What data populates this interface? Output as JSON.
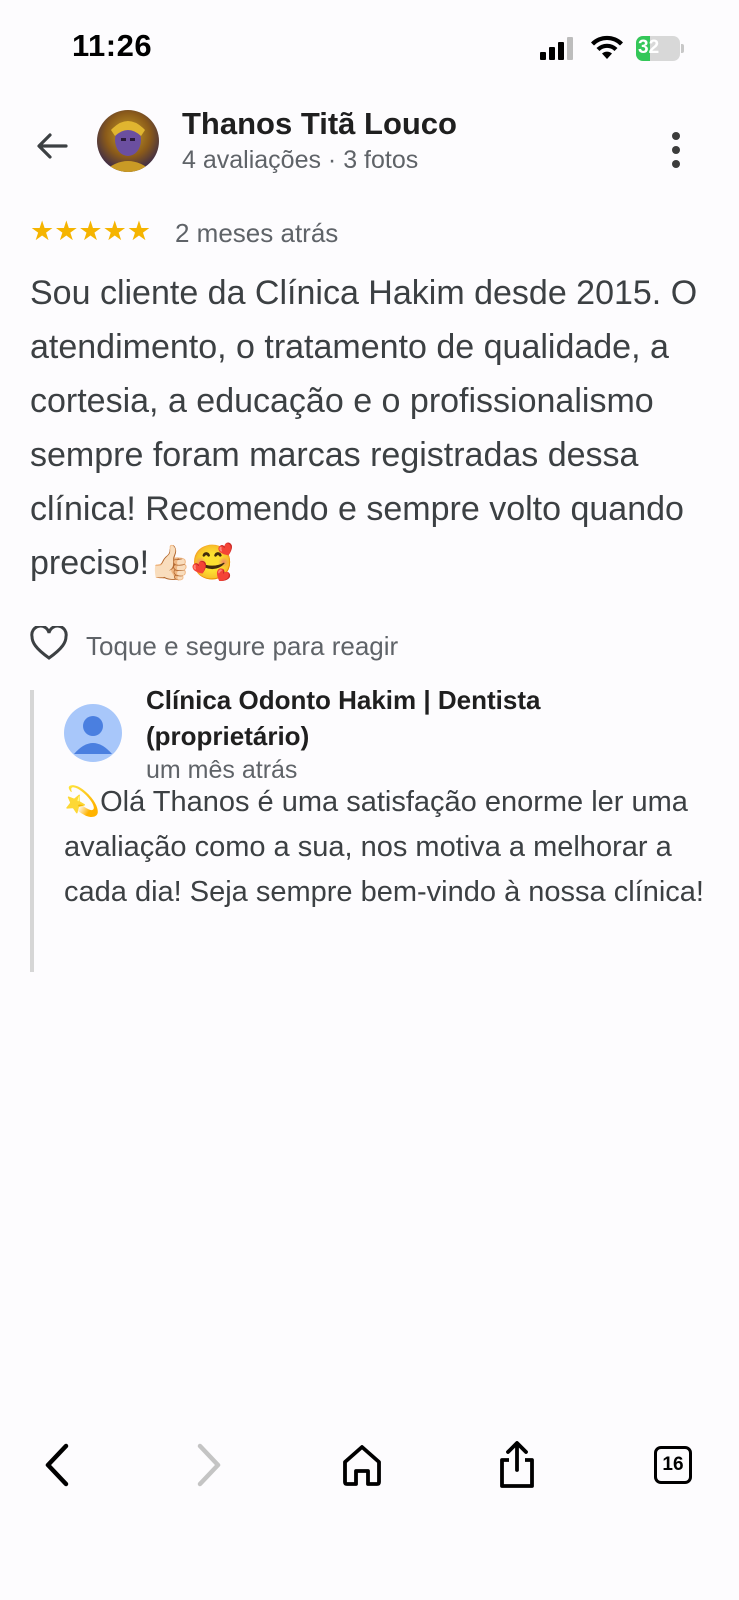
{
  "status_bar": {
    "time": "11:26",
    "battery_percent": "32",
    "battery_level": 0.32
  },
  "header": {
    "user_name": "Thanos Titã Louco",
    "user_meta": "4 avaliações · 3 fotos"
  },
  "review": {
    "stars": "★★★★★",
    "rating": 5,
    "time": "2 meses atrás",
    "text": "Sou cliente da Clínica Hakim desde 2015. O atendimento, o tratamento de qualidade, a cortesia, a educação e o profissionalismo sempre foram marcas registradas dessa clínica! Recomendo e sempre volto quando preciso!👍🏻🥰"
  },
  "react": {
    "label": "Toque e segure para reagir"
  },
  "owner_reply": {
    "name": "Clínica Odonto Hakim | Dentista (proprietário)",
    "time": "um mês atrás",
    "text": "💫Olá Thanos é uma satisfação enorme ler uma avaliação como a sua, nos motiva a melhorar a cada dia! Seja sempre bem-vindo à nossa clínica!"
  },
  "toolbar": {
    "tabs_count": "16"
  },
  "colors": {
    "star": "#f5b400",
    "battery": "#34c759",
    "secondary_text": "#5f6368",
    "owner_avatar": "#a8c7fa"
  },
  "icons": [
    "back-arrow-icon",
    "more-vert-icon",
    "heart-icon",
    "browser-back-icon",
    "browser-forward-icon",
    "home-icon",
    "share-icon",
    "tabs-icon",
    "signal-icon",
    "wifi-icon",
    "battery-icon"
  ]
}
